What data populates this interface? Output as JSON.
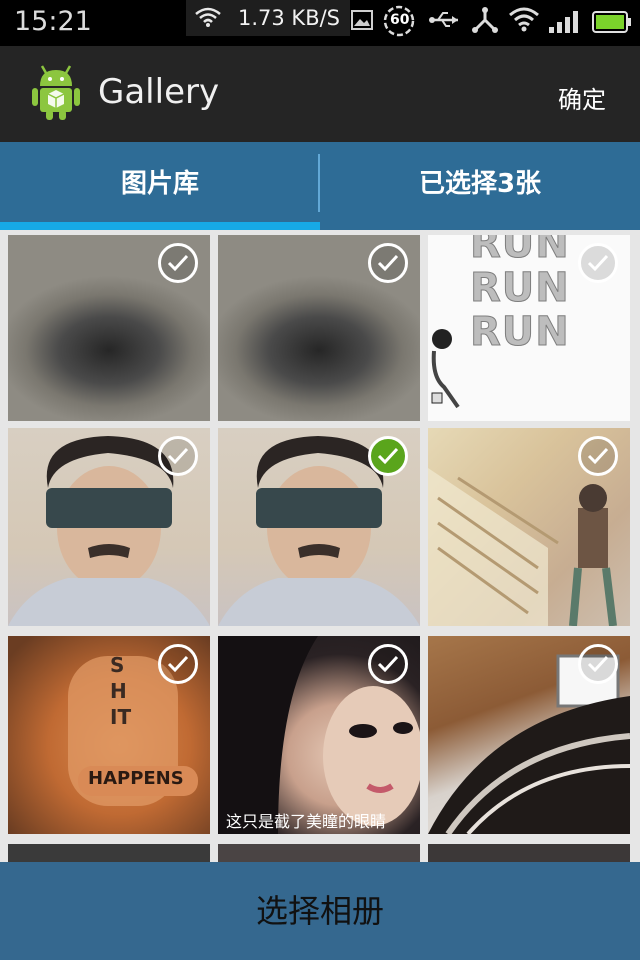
{
  "status_bar": {
    "time": "15:21",
    "net_speed": "1.73 KB/S",
    "timer_badge": "60",
    "icons": [
      "wifi-icon",
      "image-notification-icon",
      "timer-icon",
      "usb-icon",
      "usb-debug-icon",
      "wifi-icon",
      "signal-icon",
      "battery-icon"
    ]
  },
  "action_bar": {
    "title": "Gallery",
    "confirm_label": "确定"
  },
  "tabs": [
    {
      "label": "图片库",
      "selected": true
    },
    {
      "label": "已选择3张",
      "selected": false
    }
  ],
  "photos": [
    {
      "picture": "blurred-gray-photo",
      "checked": false
    },
    {
      "picture": "blurred-gray-photo",
      "checked": false
    },
    {
      "picture": "run-run-poster",
      "checked": false,
      "text_lines": [
        "RUN",
        "RUN",
        "RUN"
      ]
    },
    {
      "picture": "man-with-visor-glasses",
      "checked": false
    },
    {
      "picture": "man-with-visor-glasses",
      "checked": true
    },
    {
      "picture": "anime-library-scene",
      "checked": false
    },
    {
      "picture": "shit-happens-fists",
      "checked": false,
      "knuckle_text": "SHIT",
      "hand_text": "HAPPENS"
    },
    {
      "picture": "girl-selfie",
      "checked": false,
      "caption_fragment": "这只是截了美瞳的眼睛"
    },
    {
      "picture": "girl-long-hair",
      "checked": false
    }
  ],
  "colors": {
    "tab_bar": "#2e6c96",
    "tab_indicator": "#17a9e6",
    "check_on": "#5aa51c",
    "bottom_bar": "#35688f"
  },
  "bottom_button": {
    "label": "选择相册"
  }
}
